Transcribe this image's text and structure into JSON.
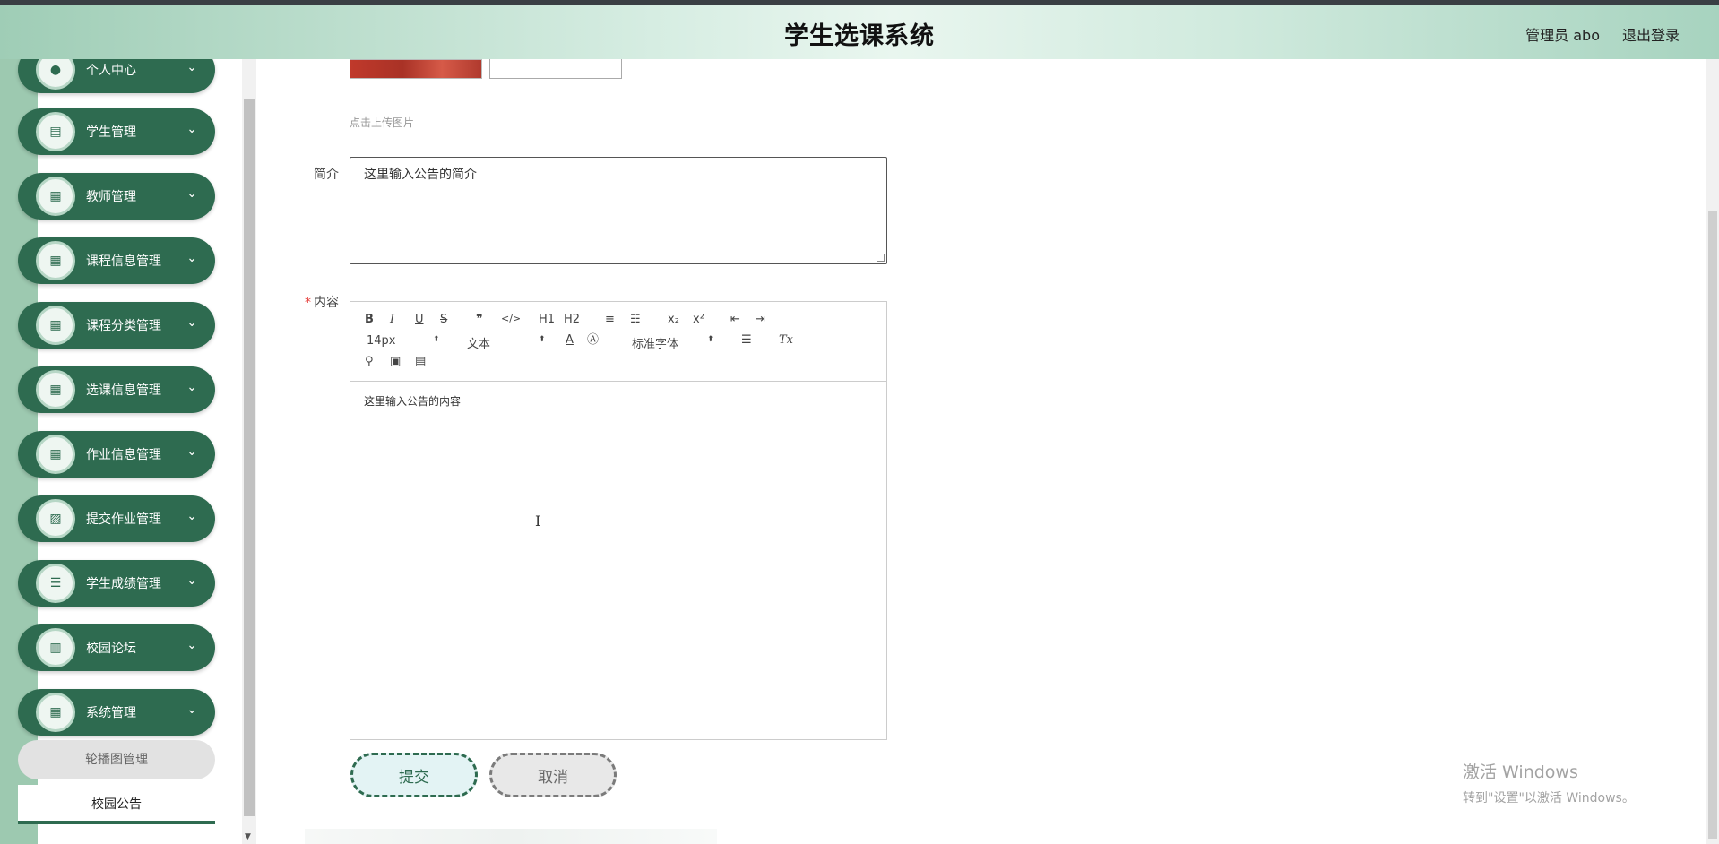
{
  "header": {
    "title": "学生选课系统",
    "user": "管理员 abo",
    "logout": "退出登录"
  },
  "sidebar": {
    "items": [
      {
        "label": "个人中心",
        "icon": "person-icon",
        "glyph": "●"
      },
      {
        "label": "学生管理",
        "icon": "clipboard-icon",
        "glyph": "▤"
      },
      {
        "label": "教师管理",
        "icon": "grid-icon",
        "glyph": "▦"
      },
      {
        "label": "课程信息管理",
        "icon": "grid-icon",
        "glyph": "▦"
      },
      {
        "label": "课程分类管理",
        "icon": "grid-icon",
        "glyph": "▦"
      },
      {
        "label": "选课信息管理",
        "icon": "grid-icon",
        "glyph": "▦"
      },
      {
        "label": "作业信息管理",
        "icon": "grid-icon",
        "glyph": "▦"
      },
      {
        "label": "提交作业管理",
        "icon": "chart-icon",
        "glyph": "▨"
      },
      {
        "label": "学生成绩管理",
        "icon": "list-icon",
        "glyph": "☰"
      },
      {
        "label": "校园论坛",
        "icon": "bar-chart-icon",
        "glyph": "▥"
      },
      {
        "label": "系统管理",
        "icon": "grid-icon",
        "glyph": "▦"
      }
    ],
    "sub_items": [
      "轮播图管理",
      "校园公告"
    ],
    "chevron": "⌄"
  },
  "form": {
    "upload_hint": "点击上传图片",
    "intro_label": "简介",
    "intro_value": "这里输入公告的简介",
    "content_label": "内容",
    "required_mark": "*",
    "content_value": "这里输入公告的内容",
    "submit_label": "提交",
    "cancel_label": "取消"
  },
  "editor": {
    "toolbar_row1": [
      "B",
      "I",
      "U",
      "S",
      "❞",
      "</>",
      "H1",
      "H2",
      "≡",
      "☷",
      "x₂",
      "x²",
      "⇤",
      "⇥"
    ],
    "font_size": "14px",
    "block_type": "文本",
    "font_family": "标准字体",
    "color_icon": "A",
    "bg_icon": "Ⓐ",
    "align_icon": "☰",
    "clear_icon": "Tx",
    "link_icon": "⚲",
    "image_icon": "▣",
    "video_icon": "▤",
    "select_arrow": "⬍",
    "cursor": "I"
  },
  "watermark": {
    "line1": "激活 Windows",
    "line2": "转到\"设置\"以激活 Windows。"
  }
}
